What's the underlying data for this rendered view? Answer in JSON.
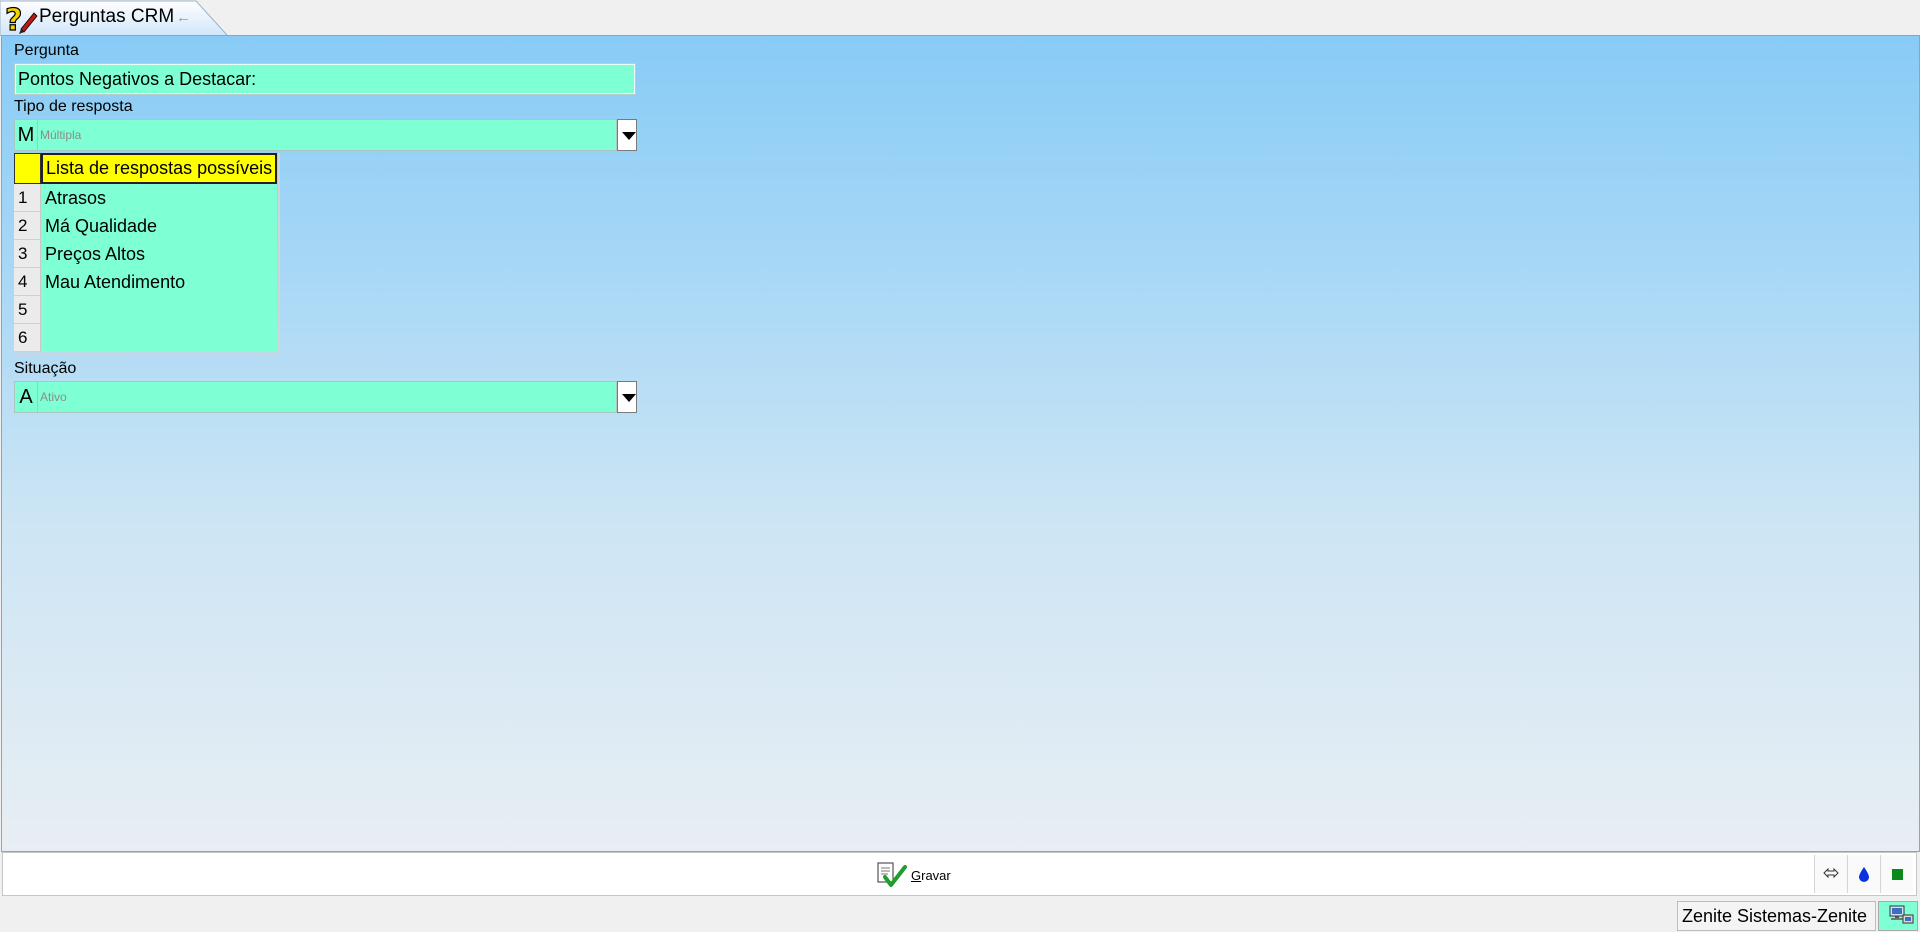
{
  "tab": {
    "title": "Perguntas CRM",
    "back_arrow": "←",
    "icon": "question-edit-icon"
  },
  "form": {
    "pergunta_label": "Pergunta",
    "pergunta_value": "Pontos Negativos a Destacar:",
    "tipo_label": "Tipo de resposta",
    "tipo_code": "M",
    "tipo_desc": "Múltipla",
    "situacao_label": "Situação",
    "situacao_code": "A",
    "situacao_desc": "Ativo"
  },
  "grid": {
    "header": "Lista de respostas possíveis",
    "rows": [
      {
        "num": "1",
        "value": "Atrasos"
      },
      {
        "num": "2",
        "value": "Má Qualidade"
      },
      {
        "num": "3",
        "value": "Preços Altos"
      },
      {
        "num": "4",
        "value": "Mau Atendimento"
      },
      {
        "num": "5",
        "value": ""
      },
      {
        "num": "6",
        "value": ""
      }
    ]
  },
  "toolbar": {
    "save_prefix": "G",
    "save_rest": "ravar"
  },
  "status": {
    "company": "Zenite Sistemas-Zenite"
  },
  "colors": {
    "field_bg": "#7fffd4",
    "header_bg": "#ffff00",
    "panel_top": "#88cbf6",
    "panel_bottom": "#e8eef3"
  }
}
